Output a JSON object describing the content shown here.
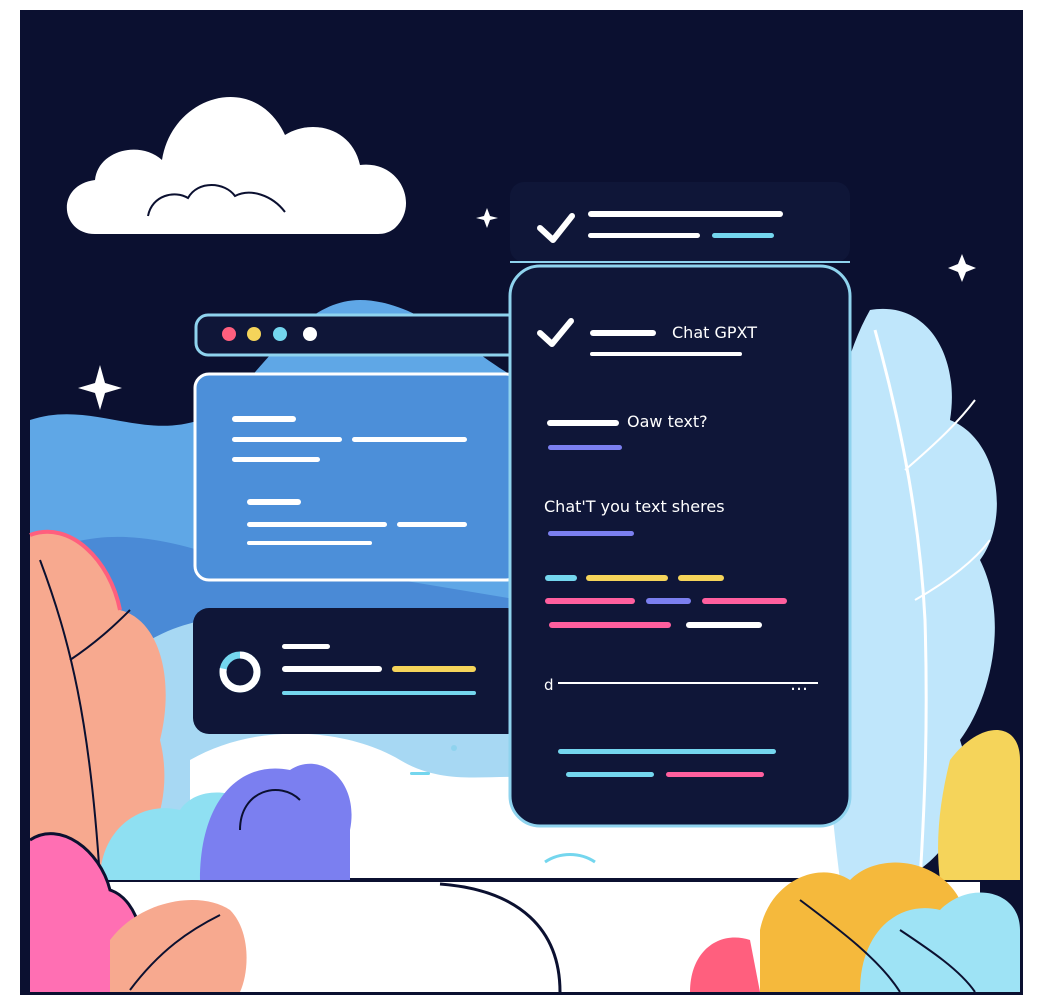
{
  "colors": {
    "night": "#0b1030",
    "panel": "#0f1638",
    "panel_border": "#8fd3ee",
    "window_blue": "#4c8fd9",
    "line_white": "#ffffff",
    "line_cyan": "#74d6ee",
    "line_purple": "#7b7ff0",
    "line_pink": "#ff5f9e",
    "line_yellow": "#f5d45a"
  },
  "chat": {
    "title": "Chat GPXT",
    "question": "Oaw text?",
    "answer": "Chat'T you text sheres",
    "input_prefix": "d",
    "input_suffix": "…"
  },
  "icons": {
    "header_check": "check-icon",
    "chat_check": "check-icon",
    "progress_ring": "progress-ring-icon",
    "cloud": "cloud-icon",
    "sparkle": "sparkle-icon"
  },
  "stats": {
    "progress_fraction": 0.78
  }
}
